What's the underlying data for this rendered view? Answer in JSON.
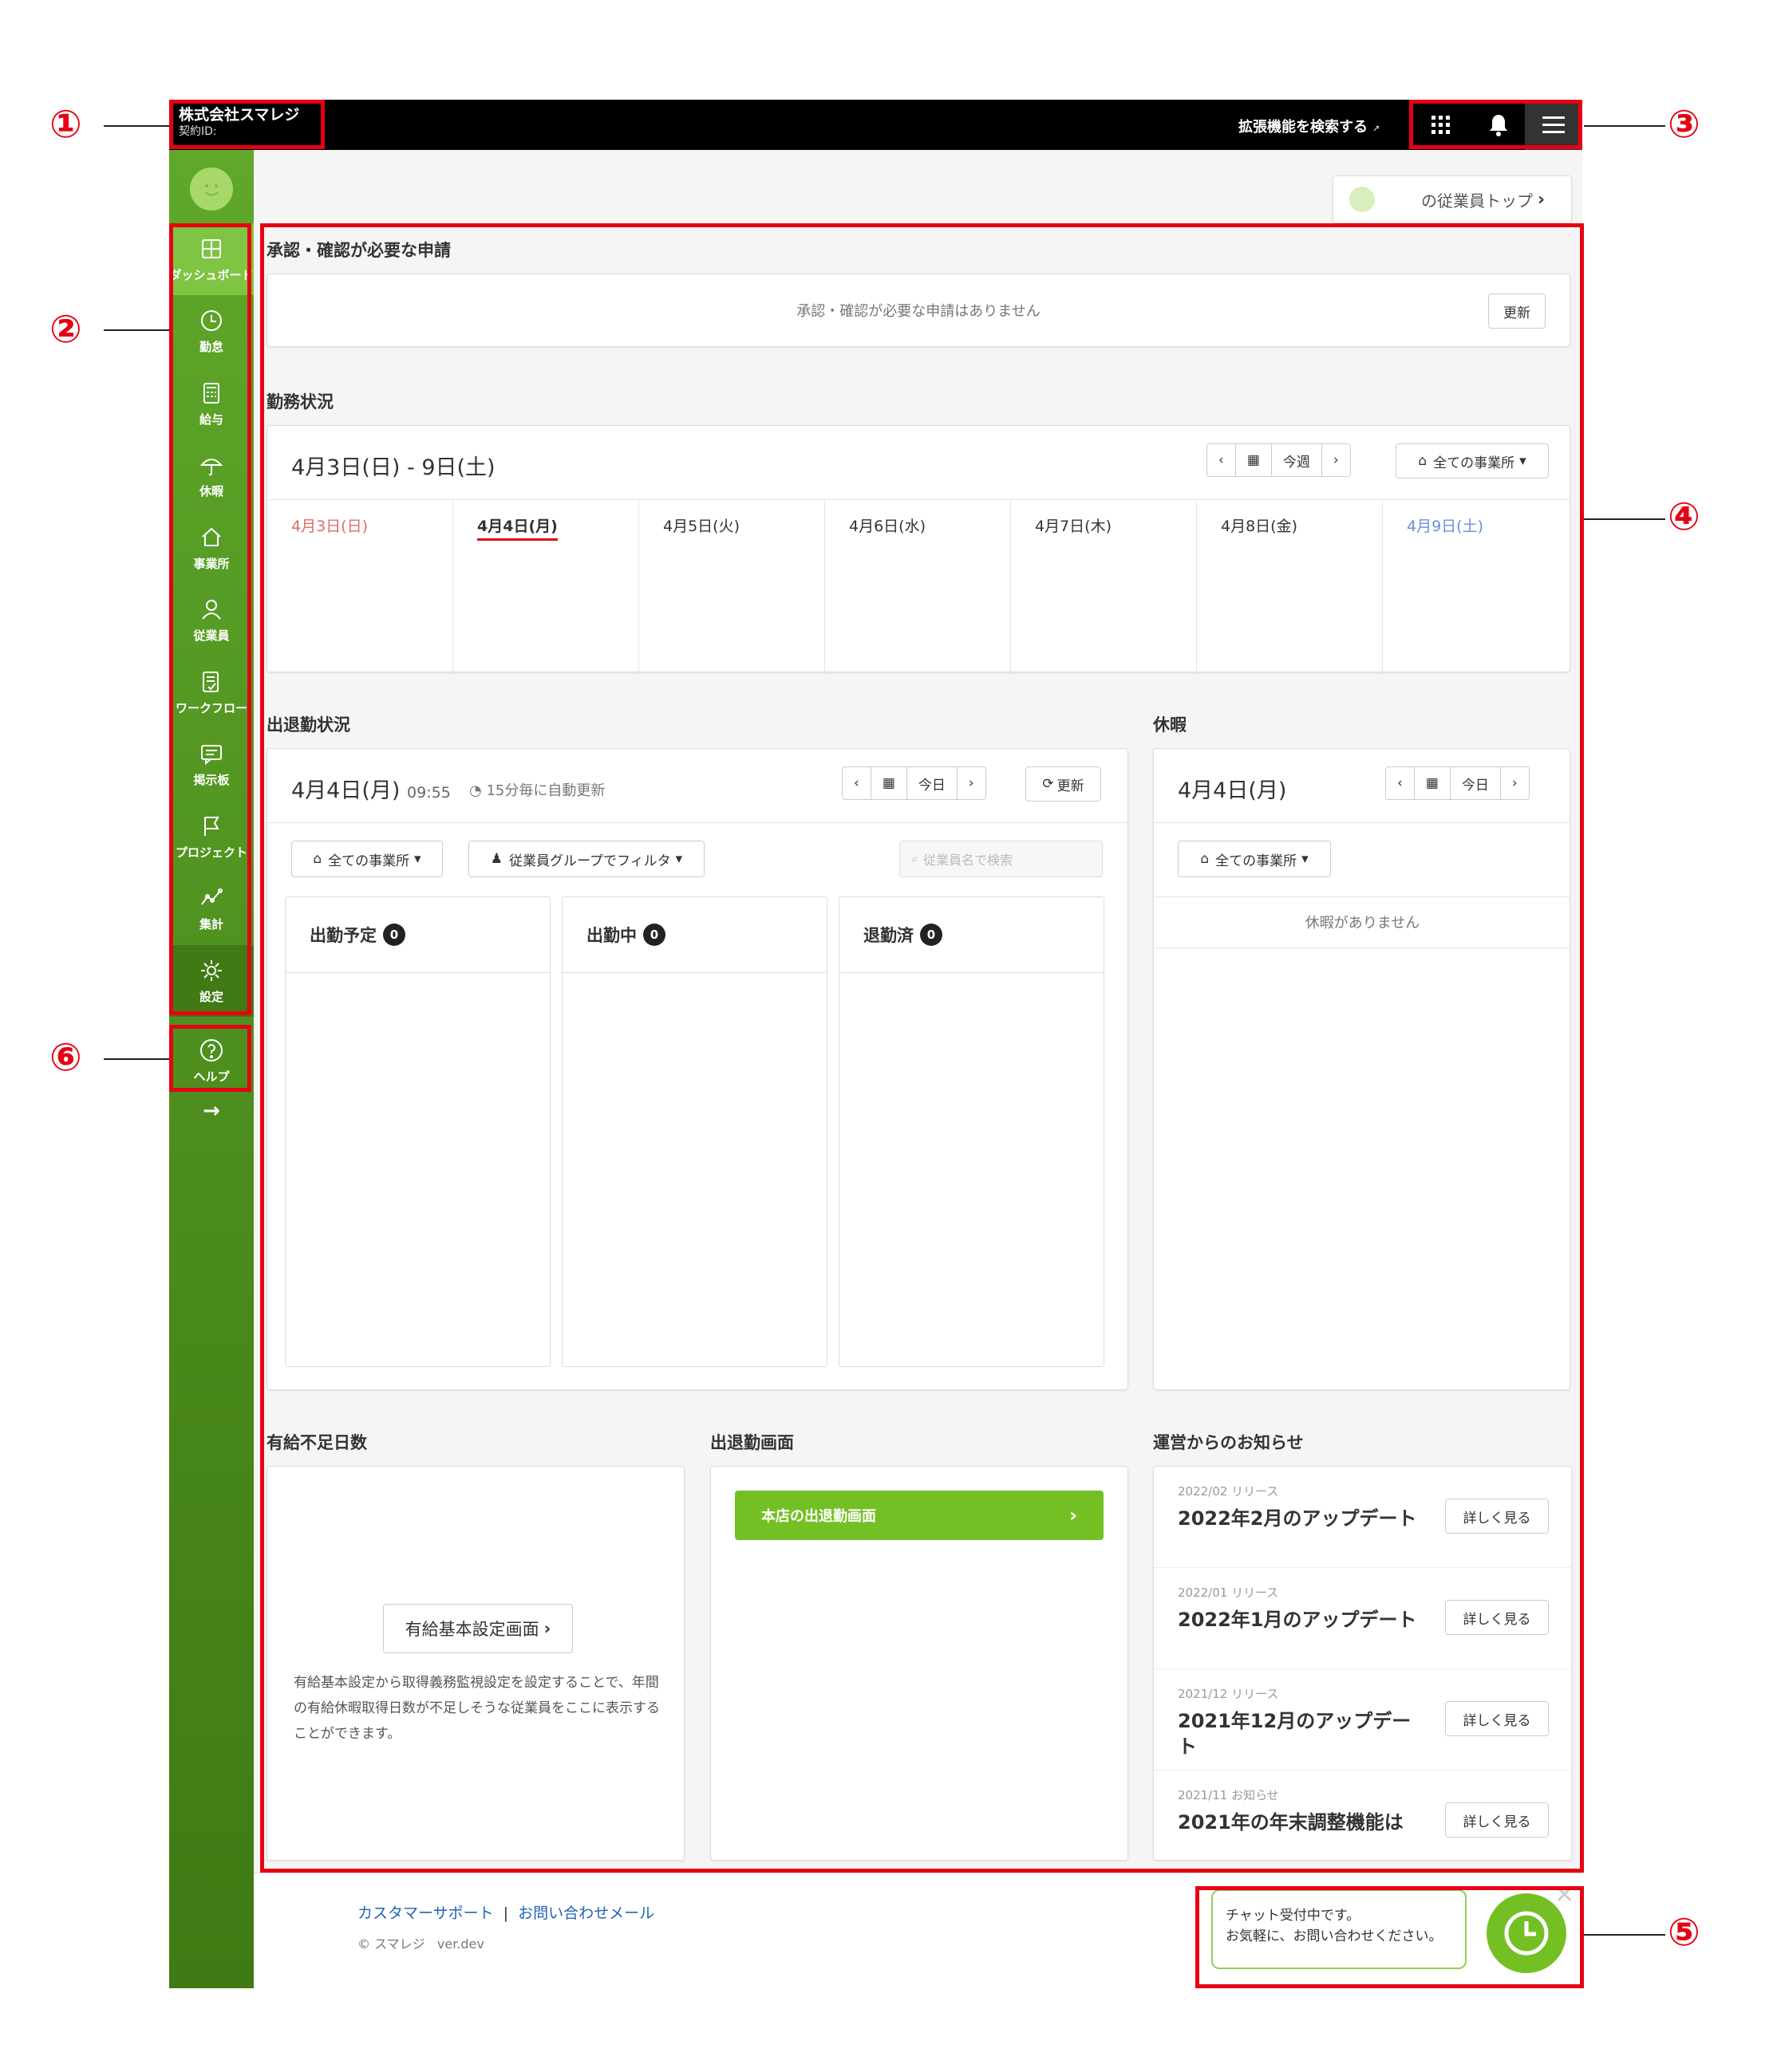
{
  "callouts": [
    "①",
    "②",
    "③",
    "④",
    "⑤",
    "⑥"
  ],
  "topbar": {
    "company_name": "株式会社スマレジ",
    "contract_label": "契約ID:",
    "extension_search": "拡張機能を検索する",
    "extension_mark": "↗"
  },
  "sidebar": {
    "items": [
      {
        "label": "ダッシュボード",
        "icon": "dashboard-icon"
      },
      {
        "label": "勤怠",
        "icon": "clock-icon"
      },
      {
        "label": "給与",
        "icon": "calculator-icon"
      },
      {
        "label": "休暇",
        "icon": "umbrella-icon"
      },
      {
        "label": "事業所",
        "icon": "home-icon"
      },
      {
        "label": "従業員",
        "icon": "person-icon"
      },
      {
        "label": "ワークフロー",
        "icon": "checklist-icon"
      },
      {
        "label": "掲示板",
        "icon": "message-icon"
      },
      {
        "label": "プロジェクト",
        "icon": "flag-icon"
      },
      {
        "label": "集計",
        "icon": "chart-icon"
      },
      {
        "label": "設定",
        "icon": "gear-icon"
      }
    ],
    "help_label": "ヘルプ",
    "expand_arrow": "→"
  },
  "employee_top": "の従業員トップ",
  "approvals": {
    "title": "承認・確認が必要な申請",
    "empty": "承認・確認が必要な申請はありません",
    "refresh": "更新"
  },
  "work_status": {
    "title": "勤務状況",
    "range": "4月3日(日) - 9日(土)",
    "nav_prev": "‹",
    "nav_this_week": "今週",
    "nav_next": "›",
    "office_filter": "全ての事業所",
    "days": [
      "4月3日(日)",
      "4月4日(月)",
      "4月5日(火)",
      "4月6日(水)",
      "4月7日(木)",
      "4月8日(金)",
      "4月9日(土)"
    ]
  },
  "attendance": {
    "title": "出退勤状況",
    "date": "4月4日(月)",
    "time": "09:55",
    "auto_refresh": "15分毎に自動更新",
    "today": "今日",
    "refresh": "更新",
    "office_filter": "全ての事業所",
    "group_filter": "従業員グループでフィルタ",
    "search_placeholder": "従業員名で検索",
    "columns": [
      {
        "label": "出勤予定",
        "count": "0"
      },
      {
        "label": "出勤中",
        "count": "0"
      },
      {
        "label": "退勤済",
        "count": "0"
      }
    ]
  },
  "leave": {
    "title": "休暇",
    "date": "4月4日(月)",
    "today": "今日",
    "office_filter": "全ての事業所",
    "empty": "休暇がありません"
  },
  "paid_leave": {
    "title": "有給不足日数",
    "button": "有給基本設定画面",
    "description": "有給基本設定から取得義務監視設定を設定することで、年間の有給休暇取得日数が不足しそうな従業員をここに表示することができます。"
  },
  "clock_screen": {
    "title": "出退勤画面",
    "button": "本店の出退勤画面"
  },
  "news": {
    "title": "運営からのお知らせ",
    "items": [
      {
        "date": "2022/02 リリース",
        "title": "2022年2月のアップデート",
        "button": "詳しく見る"
      },
      {
        "date": "2022/01 リリース",
        "title": "2022年1月のアップデート",
        "button": "詳しく見る"
      },
      {
        "date": "2021/12 リリース",
        "title": "2021年12月のアップデート",
        "button": "詳しく見る"
      },
      {
        "date": "2021/11 お知らせ",
        "title": "2021年の年末調整機能は",
        "button": "詳しく見る"
      }
    ]
  },
  "footer": {
    "support": "カスタマーサポート",
    "separator": "|",
    "contact": "お問い合わせメール",
    "copyright": "© スマレジ",
    "version": "ver.dev"
  },
  "chat": {
    "line1": "チャット受付中です。",
    "line2": "お気軽に、お問い合わせください。"
  },
  "colors": {
    "sidebar": "#4a8a1c",
    "accent": "#74c024",
    "annotation": "#e60012",
    "sunday": "#e06b6b",
    "saturday": "#6b8fd6"
  }
}
